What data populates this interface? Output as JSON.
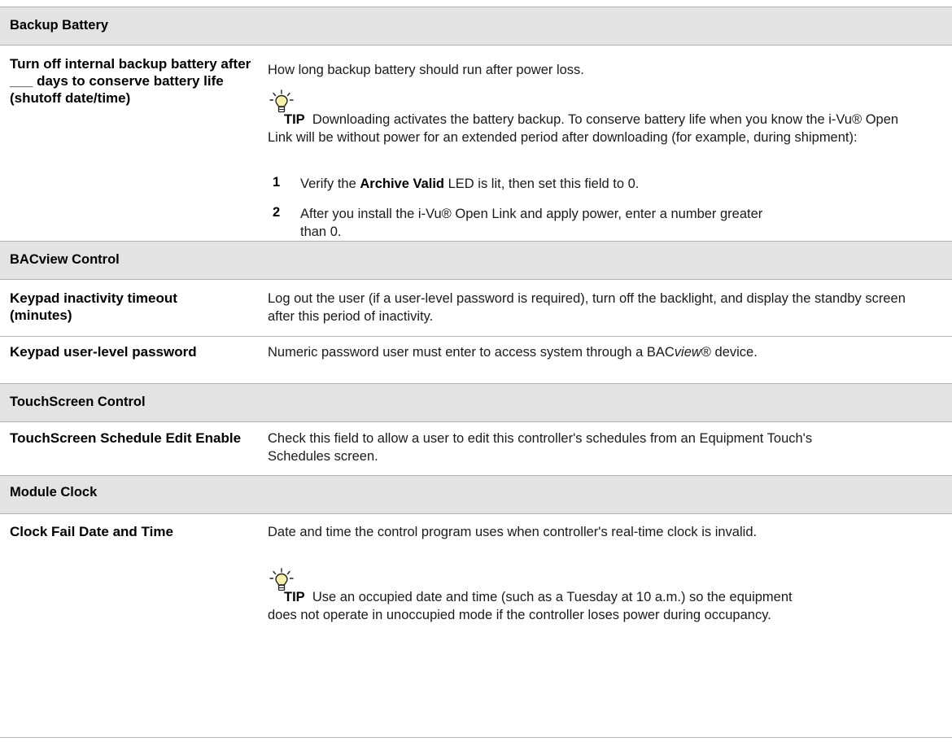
{
  "sections": {
    "backup_battery": {
      "title": "Backup Battery",
      "term": "Turn off internal backup battery after ___ days to conserve battery life (shutoff date/time)",
      "desc": "How long backup battery should run after power loss.",
      "tip_label": "TIP",
      "tip_text": "Downloading activates the battery backup. To conserve battery life when you know the i-Vu® Open Link will be without power for an extended period after downloading (for example, during shipment):",
      "steps": [
        {
          "num": "1",
          "pre": "Verify the ",
          "bold": "Archive Valid",
          "post": " LED is lit, then set this field to 0."
        },
        {
          "num": "2",
          "text": "After you install the i-Vu® Open Link and apply power, enter a number greater than 0."
        }
      ]
    },
    "bacview_control": {
      "title": "BACview Control",
      "rows": [
        {
          "term": "Keypad inactivity timeout (minutes)",
          "desc": "Log out the user (if a user-level password is required), turn off the backlight, and display the standby screen after this period of inactivity."
        },
        {
          "term": "Keypad user-level password",
          "desc_pre": "Numeric password user must enter to access system through a BAC",
          "desc_italic": "view",
          "desc_post": "® device."
        }
      ]
    },
    "touchscreen_control": {
      "title": "TouchScreen Control",
      "term": "TouchScreen Schedule Edit Enable",
      "desc": "Check this field to allow a user to edit this controller's schedules from an Equipment Touch's Schedules screen."
    },
    "module_clock": {
      "title": "Module Clock",
      "term": "Clock Fail Date and Time",
      "desc": "Date and time the control program uses when controller's real-time clock is invalid.",
      "tip_label": "TIP",
      "tip_text": "Use an occupied date and time (such as a Tuesday at 10 a.m.) so the equipment does not operate in unoccupied mode if the controller loses power during occupancy."
    }
  },
  "icon": "lightbulb-tip-icon"
}
